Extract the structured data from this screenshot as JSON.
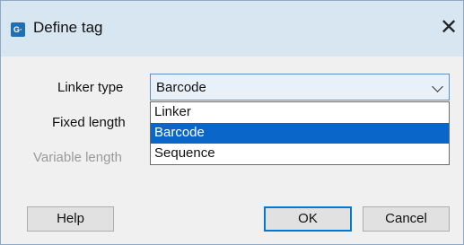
{
  "window": {
    "title": "Define tag",
    "icon_name": "app-icon",
    "icon_text": "G·",
    "close_symbol": "✕"
  },
  "form": {
    "linker_type_label": "Linker type",
    "fixed_length_label": "Fixed length",
    "variable_length_label": "Variable length",
    "linker_type_value": "Barcode",
    "options": [
      "Linker",
      "Barcode",
      "Sequence"
    ],
    "selected_option": "Barcode"
  },
  "buttons": {
    "help": "Help",
    "ok": "OK",
    "cancel": "Cancel"
  },
  "colors": {
    "titlebar": "#d8e6f2",
    "selection": "#0a66c8",
    "accent": "#0078d7"
  }
}
